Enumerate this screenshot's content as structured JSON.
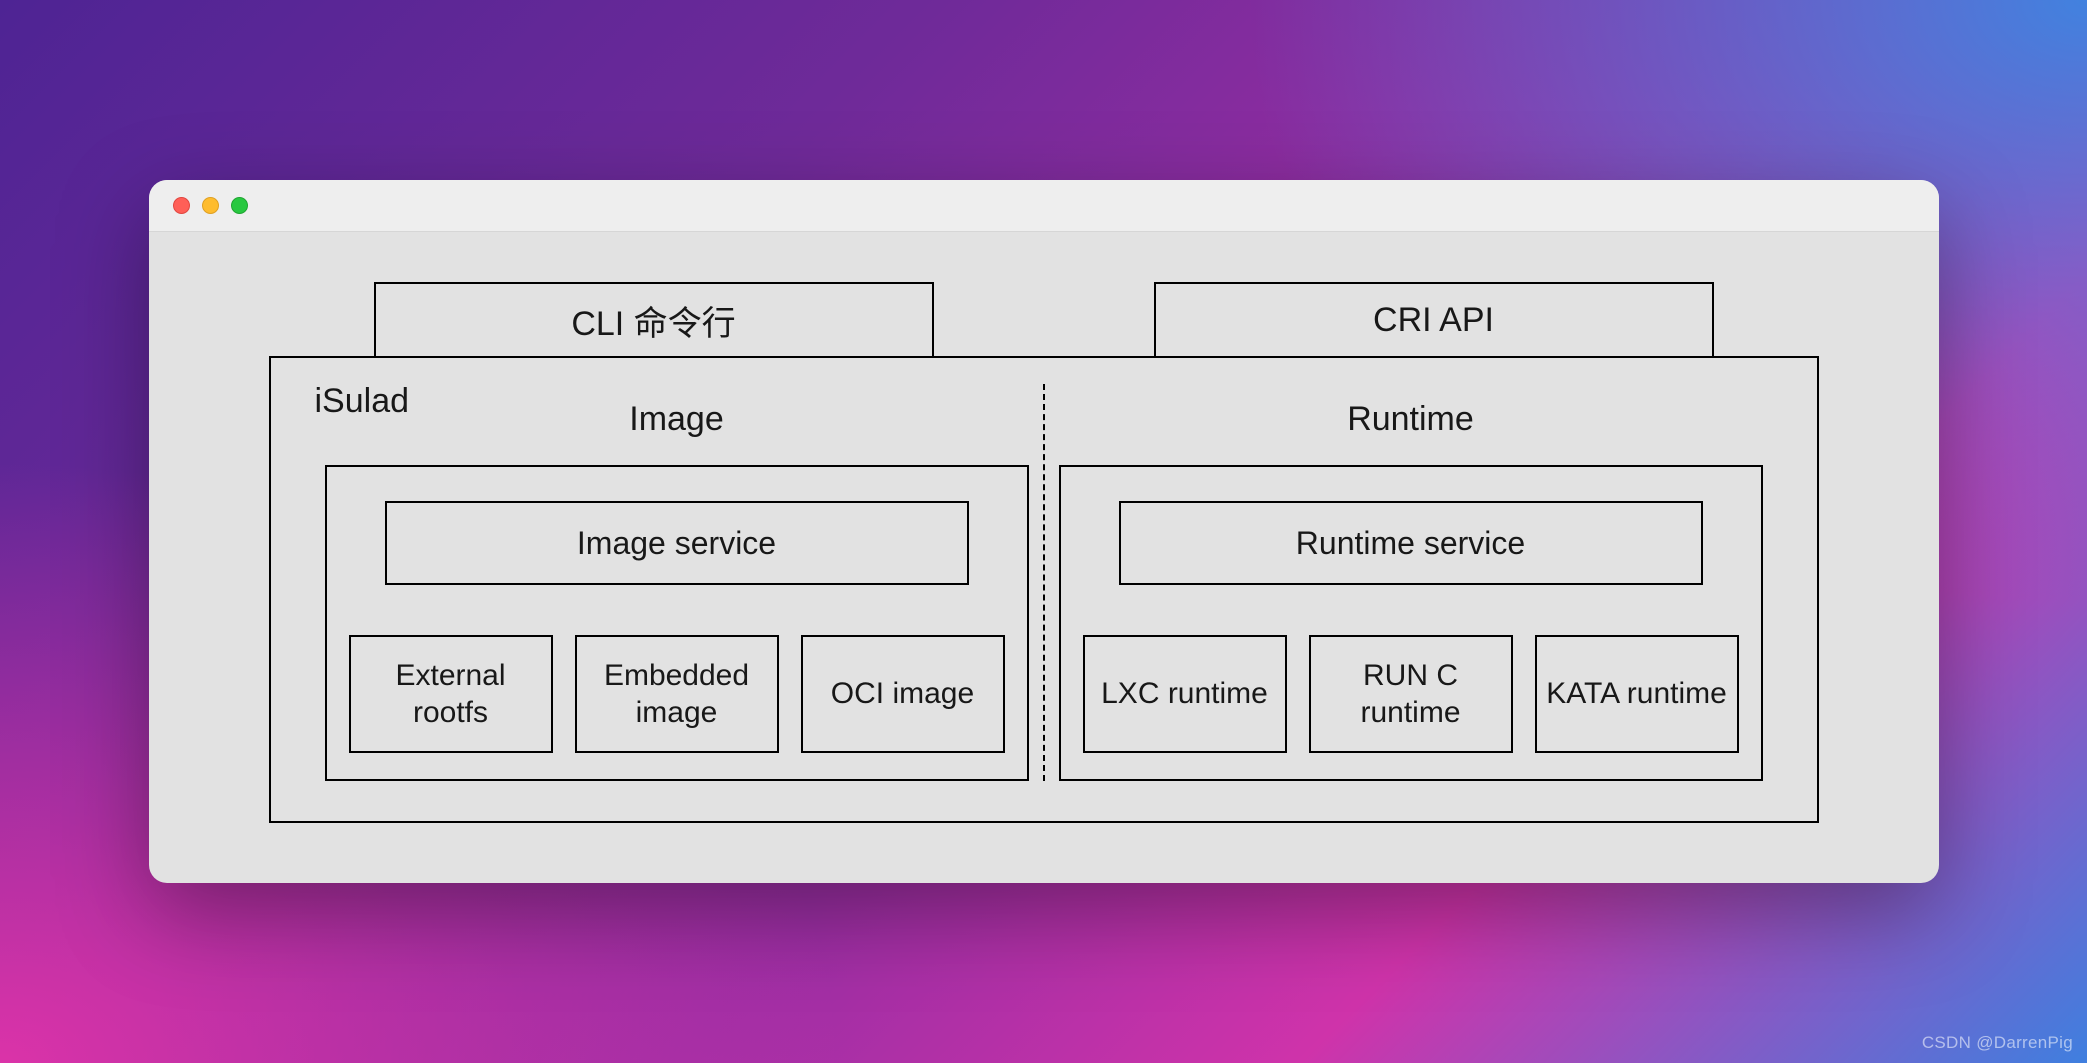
{
  "api_row": {
    "left": "CLI 命令行",
    "right": "CRI API"
  },
  "main": {
    "label": "iSulad",
    "columns": {
      "image": {
        "title": "Image",
        "service": "Image service",
        "impls": [
          "External rootfs",
          "Embedded image",
          "OCI image"
        ]
      },
      "runtime": {
        "title": "Runtime",
        "service": "Runtime service",
        "impls": [
          "LXC runtime",
          "RUN C runtime",
          "KATA runtime"
        ]
      }
    }
  },
  "watermark": "CSDN @DarrenPig"
}
